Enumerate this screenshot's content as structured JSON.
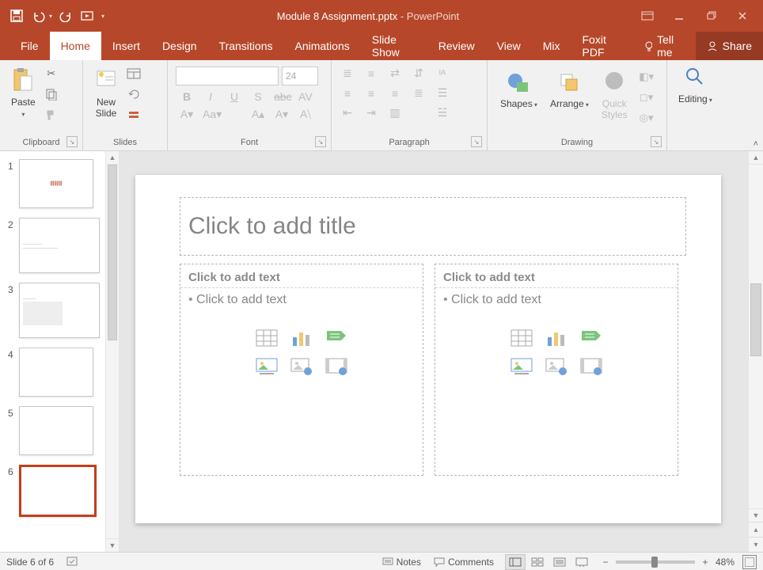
{
  "title": {
    "filename": "Module 8 Assignment.pptx",
    "appname": "PowerPoint"
  },
  "tabs": {
    "file": "File",
    "home": "Home",
    "insert": "Insert",
    "design": "Design",
    "transitions": "Transitions",
    "animations": "Animations",
    "slideshow": "Slide Show",
    "review": "Review",
    "view": "View",
    "mix": "Mix",
    "foxit": "Foxit PDF",
    "tellme": "Tell me",
    "share": "Share"
  },
  "ribbon": {
    "clipboard": {
      "paste": "Paste",
      "label": "Clipboard"
    },
    "slides": {
      "newslide": "New\nSlide",
      "label": "Slides"
    },
    "font": {
      "size": "24",
      "label": "Font"
    },
    "paragraph": {
      "label": "Paragraph"
    },
    "drawing": {
      "shapes": "Shapes",
      "arrange": "Arrange",
      "quick": "Quick\nStyles",
      "label": "Drawing"
    },
    "editing": {
      "editing": "Editing",
      "label": ""
    }
  },
  "thumbnails": {
    "items": [
      {
        "n": "1"
      },
      {
        "n": "2"
      },
      {
        "n": "3"
      },
      {
        "n": "4"
      },
      {
        "n": "5"
      },
      {
        "n": "6"
      }
    ]
  },
  "canvas": {
    "title_placeholder": "Click to add title",
    "content_hint_header": "Click to add text",
    "content_hint_body": "Click to add text"
  },
  "status": {
    "slide": "Slide 6 of 6",
    "notes": "Notes",
    "comments": "Comments",
    "zoom": "48%"
  }
}
